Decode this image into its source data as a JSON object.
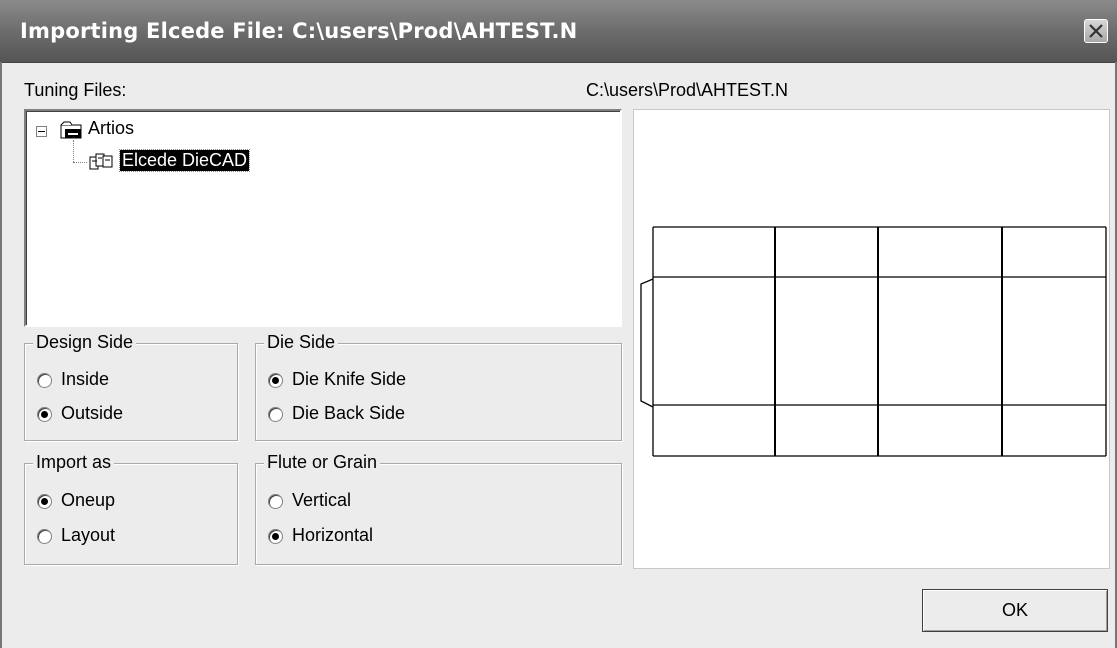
{
  "window": {
    "title": "Importing Elcede File: C:\\users\\Prod\\AHTEST.N",
    "close_icon": "close-x-icon"
  },
  "tuning_files": {
    "label": "Tuning Files:",
    "tree": [
      {
        "label": "Artios",
        "icon": "folder-icon",
        "expanded": true
      },
      {
        "label": "Elcede DieCAD",
        "icon": "tuning-file-icon",
        "selected": true
      }
    ]
  },
  "preview": {
    "path_label": "C:\\users\\Prod\\AHTEST.N"
  },
  "design_side": {
    "title": "Design Side",
    "options": [
      {
        "label": "Inside",
        "checked": false
      },
      {
        "label": "Outside",
        "checked": true
      }
    ]
  },
  "die_side": {
    "title": "Die Side",
    "options": [
      {
        "label": "Die Knife Side",
        "checked": true
      },
      {
        "label": "Die Back Side",
        "checked": false
      }
    ]
  },
  "import_as": {
    "title": "Import as",
    "options": [
      {
        "label": "Oneup",
        "checked": true
      },
      {
        "label": "Layout",
        "checked": false
      }
    ]
  },
  "flute_grain": {
    "title": "Flute or Grain",
    "options": [
      {
        "label": "Vertical",
        "checked": false
      },
      {
        "label": "Horizontal",
        "checked": true
      }
    ]
  },
  "buttons": {
    "ok_label": "OK"
  }
}
